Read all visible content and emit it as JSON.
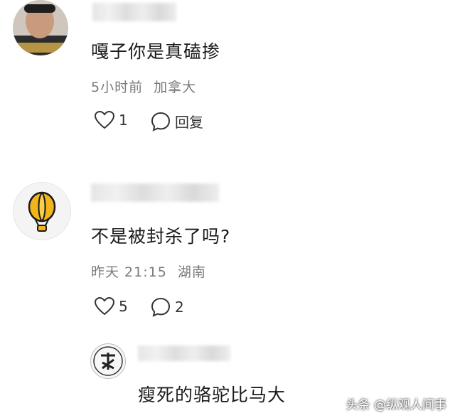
{
  "comments": [
    {
      "text": "嘎子你是真磕掺",
      "time": "5小时前",
      "location": "加拿大",
      "likes": "1",
      "reply_label": "回复"
    },
    {
      "text": "不是被封杀了吗?",
      "time": "昨天 21:15",
      "location": "湖南",
      "likes": "5",
      "replies": "2"
    },
    {
      "text": "瘦死的骆驼比马大"
    }
  ],
  "watermark": "头条 @纵观人间事",
  "icons": {
    "like": "heart-outline-icon",
    "reply": "speech-bubble-icon",
    "avatar2": "hot-air-balloon-icon"
  }
}
